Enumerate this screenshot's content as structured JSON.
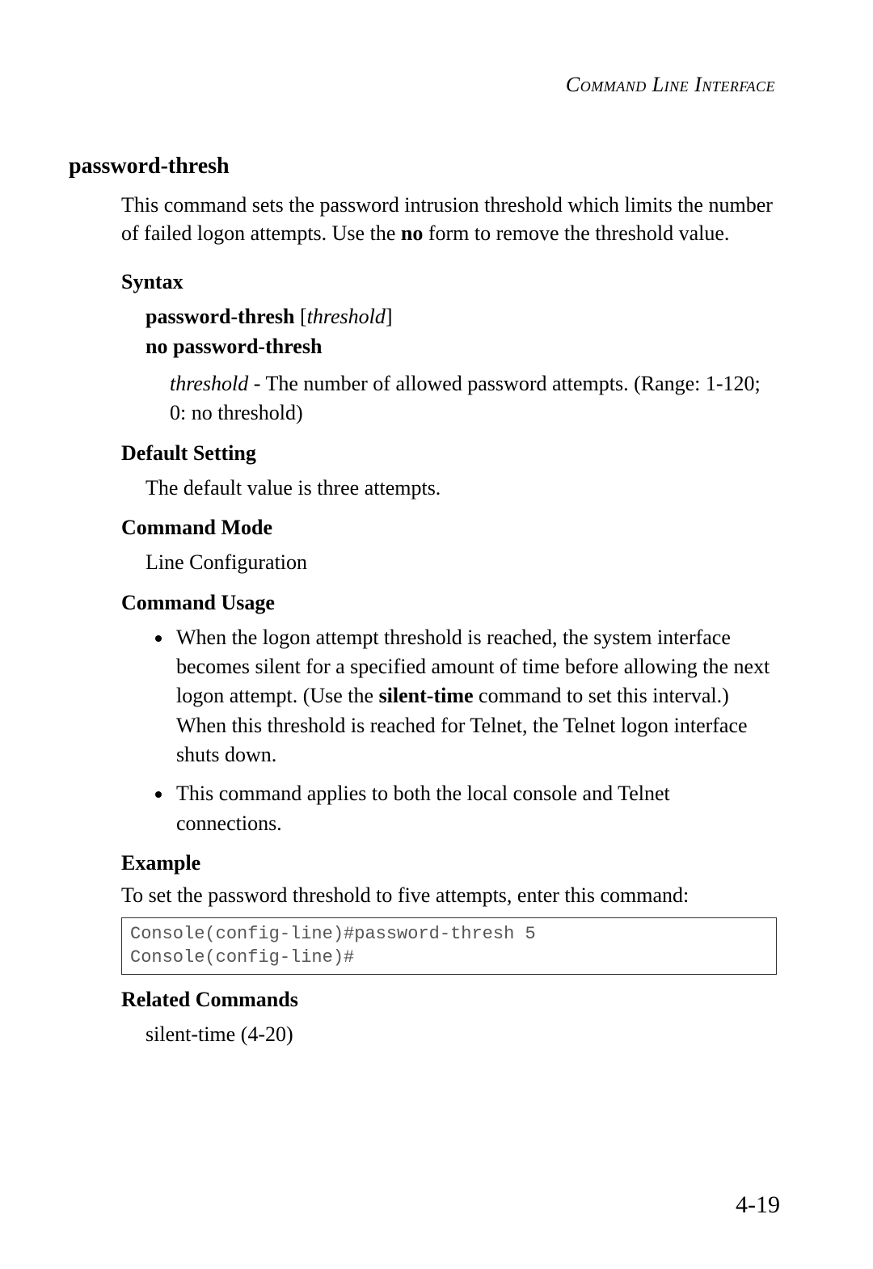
{
  "header": {
    "running": "Command Line Interface"
  },
  "title": "password-thresh",
  "intro": {
    "part1": "This command sets the password intrusion threshold which limits the number of failed logon attempts. Use the ",
    "no_word": "no",
    "part2": " form to remove the threshold value."
  },
  "syntax": {
    "heading": "Syntax",
    "line1_bold": "password-thresh",
    "line1_open": " [",
    "line1_ital": "threshold",
    "line1_close": "]",
    "line2_bold": "no password-thresh",
    "param_name": "threshold",
    "param_desc": " - The number of allowed password attempts. (Range: 1-120; 0: no threshold)"
  },
  "default": {
    "heading": "Default Setting",
    "text": "The default value is three attempts."
  },
  "mode": {
    "heading": "Command Mode",
    "text": "Line Configuration"
  },
  "usage": {
    "heading": "Command Usage",
    "item1_a": "When the logon attempt threshold is reached, the system interface becomes silent for a specified amount of time before allowing the next logon attempt. (Use the ",
    "item1_bold": "silent-time",
    "item1_b": " command to set this interval.) When this threshold is reached for Telnet, the Telnet logon interface shuts down.",
    "item2": "This command applies to both the local console and Telnet connections."
  },
  "example": {
    "heading": "Example",
    "intro": "To set the password threshold to five attempts, enter this command:",
    "console": "Console(config-line)#password-thresh 5\nConsole(config-line)#"
  },
  "related": {
    "heading": "Related Commands",
    "text": "silent-time (4-20)"
  },
  "page_number": "4-19"
}
